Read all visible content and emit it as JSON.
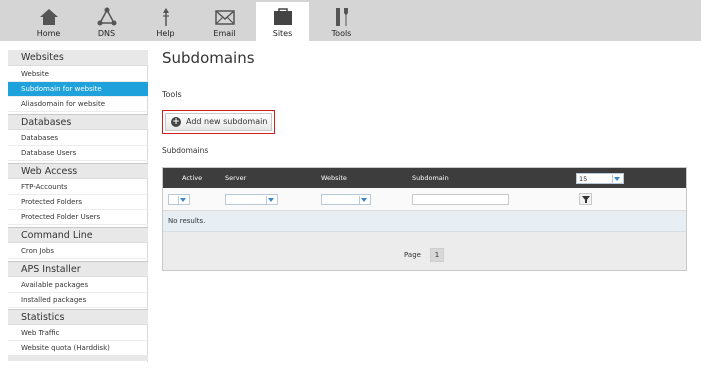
{
  "nav": {
    "tabs": [
      {
        "label": "Home",
        "icon": "home-icon"
      },
      {
        "label": "DNS",
        "icon": "network-icon"
      },
      {
        "label": "Help",
        "icon": "help-icon"
      },
      {
        "label": "Email",
        "icon": "envelope-icon"
      },
      {
        "label": "Sites",
        "icon": "folder-icon",
        "active": true
      },
      {
        "label": "Tools",
        "icon": "tools-icon"
      }
    ]
  },
  "sidebar": {
    "sections": [
      {
        "title": "Websites",
        "items": [
          "Website",
          "Subdomain for website",
          "Aliasdomain for website"
        ]
      },
      {
        "title": "Databases",
        "items": [
          "Databases",
          "Database Users"
        ]
      },
      {
        "title": "Web Access",
        "items": [
          "FTP-Accounts",
          "Protected Folders",
          "Protected Folder Users"
        ]
      },
      {
        "title": "Command Line",
        "items": [
          "Cron Jobs"
        ]
      },
      {
        "title": "APS Installer",
        "items": [
          "Available packages",
          "Installed packages"
        ]
      },
      {
        "title": "Statistics",
        "items": [
          "Web Traffic",
          "Website quota (Harddisk)"
        ]
      }
    ],
    "active_item": "Subdomain for website"
  },
  "main": {
    "title": "Subdomains",
    "tools_label": "Tools",
    "add_button_label": "Add new subdomain",
    "list_label": "Subdomains",
    "table": {
      "columns": [
        "Active",
        "Server",
        "Website",
        "Subdomain"
      ],
      "page_size": "15",
      "empty_text": "No results.",
      "page_label": "Page",
      "current_page": "1"
    }
  },
  "colors": {
    "accent": "#1fa1dc",
    "highlight_border": "#d01f1f",
    "header_dark": "#3d3d3d",
    "topbar": "#d5d5d5"
  }
}
